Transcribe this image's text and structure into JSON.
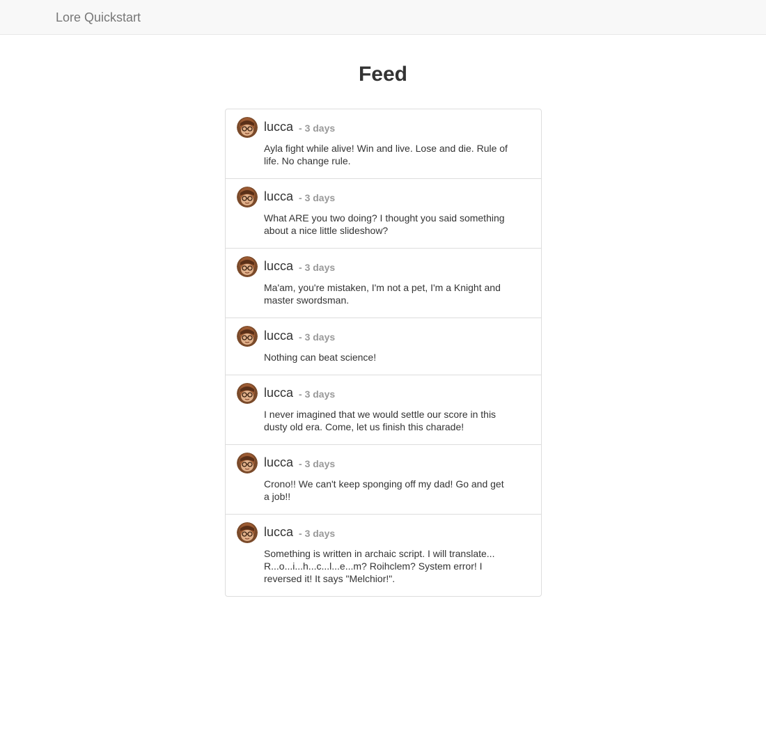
{
  "navbar": {
    "brand": "Lore Quickstart"
  },
  "page": {
    "title": "Feed"
  },
  "feed": {
    "items": [
      {
        "user": "lucca",
        "time": "- 3 days",
        "text": "Ayla fight while alive! Win and live. Lose and die. Rule of life. No change rule.",
        "avatar_icon": "user-avatar-icon"
      },
      {
        "user": "lucca",
        "time": "- 3 days",
        "text": "What ARE you two doing? I thought you said something about a nice little slideshow?",
        "avatar_icon": "user-avatar-icon"
      },
      {
        "user": "lucca",
        "time": "- 3 days",
        "text": "Ma'am, you're mistaken, I'm not a pet, I'm a Knight and master swordsman.",
        "avatar_icon": "user-avatar-icon"
      },
      {
        "user": "lucca",
        "time": "- 3 days",
        "text": "Nothing can beat science!",
        "avatar_icon": "user-avatar-icon"
      },
      {
        "user": "lucca",
        "time": "- 3 days",
        "text": "I never imagined that we would settle our score in this dusty old era. Come, let us finish this charade!",
        "avatar_icon": "user-avatar-icon"
      },
      {
        "user": "lucca",
        "time": "- 3 days",
        "text": "Crono!! We can't keep sponging off my dad! Go and get a job!!",
        "avatar_icon": "user-avatar-icon"
      },
      {
        "user": "lucca",
        "time": "- 3 days",
        "text": "Something is written in archaic script. I will translate... R...o...i...h...c...l...e...m? Roihclem? System error! I reversed it! It says \"Melchior!\".",
        "avatar_icon": "user-avatar-icon"
      }
    ]
  },
  "colors": {
    "navbar_bg": "#f8f8f8",
    "brand_text": "#777777",
    "border": "#dddddd",
    "timestamp_text": "#999999",
    "body_text": "#333333"
  }
}
